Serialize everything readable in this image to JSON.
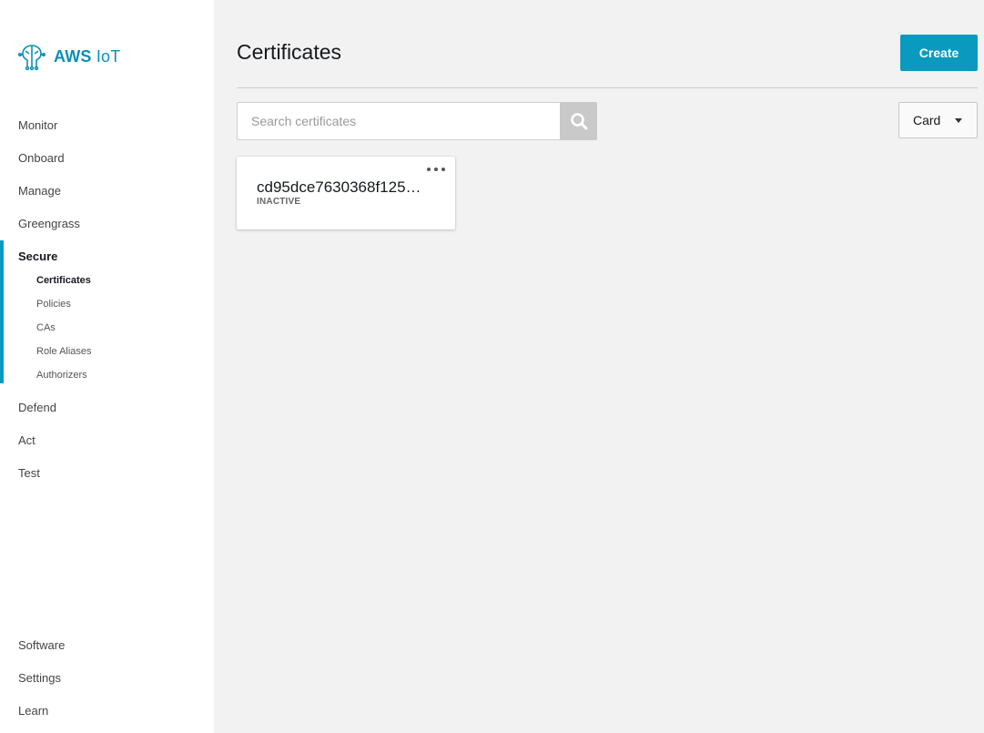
{
  "brand": {
    "name_bold": "AWS",
    "name_rest": "IoT",
    "icon": "aws-iot-logo-icon",
    "color": "#0a8fb7"
  },
  "sidebar": {
    "items_top": [
      {
        "label": "Monitor"
      },
      {
        "label": "Onboard"
      },
      {
        "label": "Manage"
      },
      {
        "label": "Greengrass"
      }
    ],
    "active_group": {
      "label": "Secure",
      "children": [
        {
          "label": "Certificates",
          "active": true
        },
        {
          "label": "Policies"
        },
        {
          "label": "CAs"
        },
        {
          "label": "Role Aliases"
        },
        {
          "label": "Authorizers"
        }
      ]
    },
    "items_after": [
      {
        "label": "Defend"
      },
      {
        "label": "Act"
      },
      {
        "label": "Test"
      }
    ],
    "items_bottom": [
      {
        "label": "Software"
      },
      {
        "label": "Settings"
      },
      {
        "label": "Learn"
      }
    ]
  },
  "main": {
    "title": "Certificates",
    "create_label": "Create",
    "search": {
      "placeholder": "Search certificates",
      "value": "",
      "icon": "search-icon"
    },
    "view_select": {
      "selected": "Card",
      "icon": "caret-down-icon"
    },
    "cards": [
      {
        "title": "cd95dce7630368f125…",
        "status": "INACTIVE",
        "menu_icon": "more-options-icon"
      }
    ]
  },
  "colors": {
    "accent": "#0a9ac0",
    "sidebar_bg": "#ffffff",
    "page_bg": "#f2f2f2"
  }
}
